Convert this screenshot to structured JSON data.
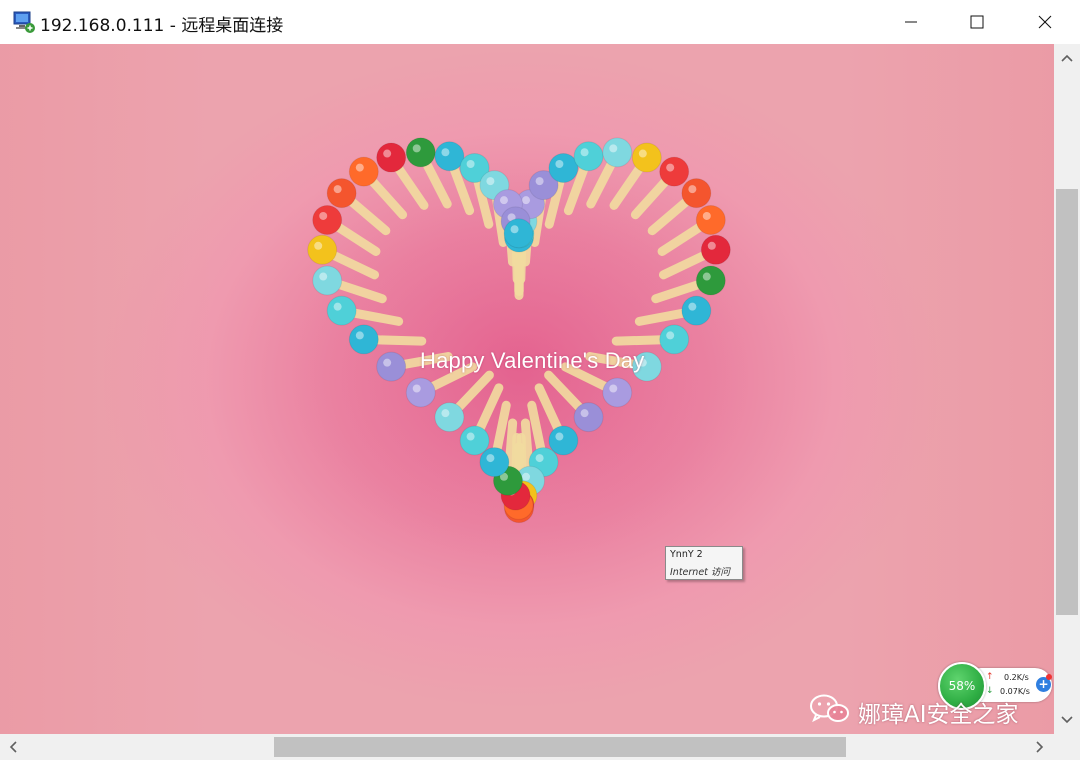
{
  "window": {
    "title": "192.168.0.111 - 远程桌面连接",
    "app_icon": "remote-desktop-icon",
    "controls": [
      "minimize-icon",
      "maximize-icon",
      "close-icon"
    ]
  },
  "remote_desktop": {
    "greeting": "Happy Valentine's Day",
    "tooltip": {
      "line1": "YnnY  2",
      "line2": "Internet 访问"
    }
  },
  "network_monitor": {
    "percent": "58%",
    "upload_speed": "0.2K/s",
    "download_speed": "0.07K/s"
  },
  "watermark": {
    "text": "娜璋AI安全之家",
    "icon": "wechat-icon"
  },
  "colors": {
    "background_pink": "#ea82a1",
    "monitor_green": "#2fae44",
    "scrollbar_track": "#f0f0f0",
    "scrollbar_thumb": "#c1c1c1"
  }
}
